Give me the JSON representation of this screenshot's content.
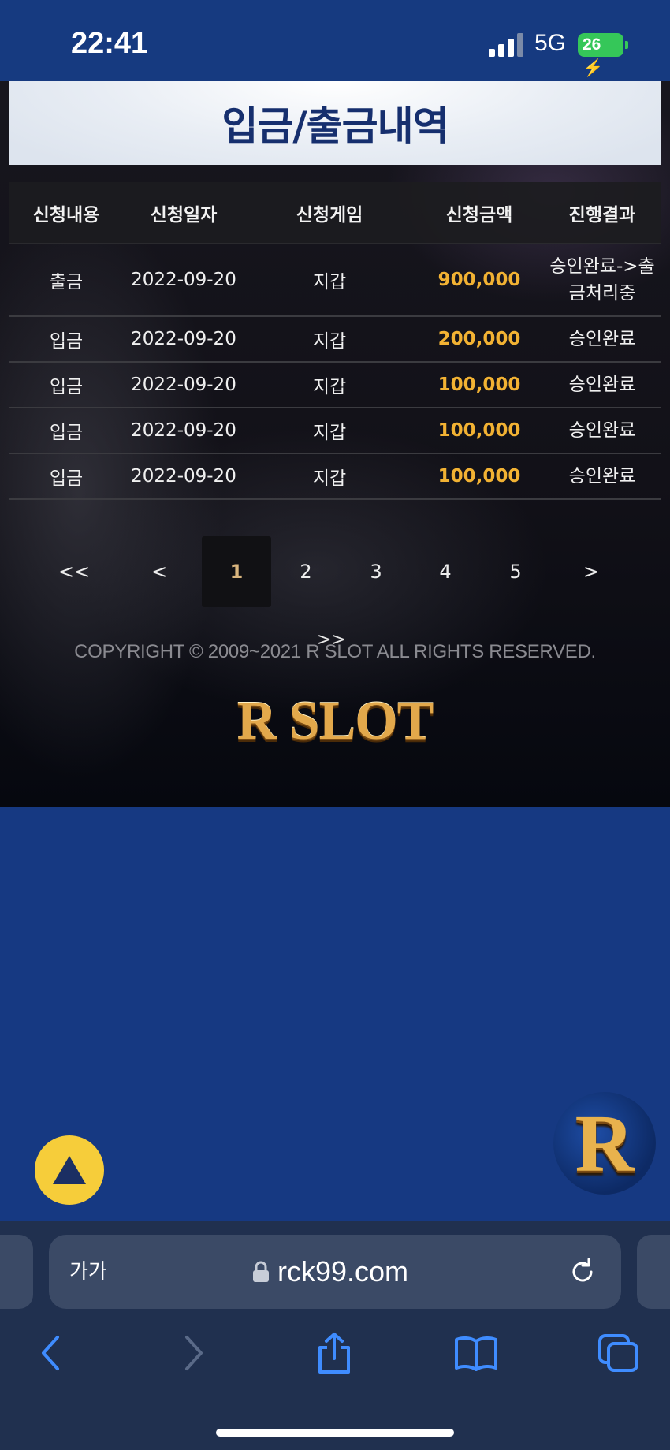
{
  "status_bar": {
    "time": "22:41",
    "network": "5G",
    "battery": "26"
  },
  "page": {
    "title": "입금/출금내역"
  },
  "table": {
    "headers": [
      "신청내용",
      "신청일자",
      "신청게임",
      "신청금액",
      "진행결과"
    ],
    "rows": [
      {
        "type": "출금",
        "date": "2022-09-20",
        "game": "지갑",
        "amount": "900,000",
        "result_line1": "승인완료->출",
        "result_line2": "금처리중"
      },
      {
        "type": "입금",
        "date": "2022-09-20",
        "game": "지갑",
        "amount": "200,000",
        "result_line1": "승인완료",
        "result_line2": ""
      },
      {
        "type": "입금",
        "date": "2022-09-20",
        "game": "지갑",
        "amount": "100,000",
        "result_line1": "승인완료",
        "result_line2": ""
      },
      {
        "type": "입금",
        "date": "2022-09-20",
        "game": "지갑",
        "amount": "100,000",
        "result_line1": "승인완료",
        "result_line2": ""
      },
      {
        "type": "입금",
        "date": "2022-09-20",
        "game": "지갑",
        "amount": "100,000",
        "result_line1": "승인완료",
        "result_line2": ""
      }
    ]
  },
  "pagination": {
    "first": "<<",
    "prev": "<",
    "pages": [
      "1",
      "2",
      "3",
      "4",
      "5"
    ],
    "current": "1",
    "next": ">",
    "last": ">>"
  },
  "footer": {
    "copyright": "COPYRIGHT © 2009~2021 R SLOT ALL RIGHTS RESERVED.",
    "logo": "R SLOT"
  },
  "floating": {
    "r_button": "R"
  },
  "browser": {
    "text_size": "가가",
    "url": "rck99.com"
  },
  "colors": {
    "page_bg": "#163982",
    "title": "#162f6e",
    "amount": "#f2b233",
    "top_button": "#f6cd3a",
    "gold": "#e2a84b"
  }
}
